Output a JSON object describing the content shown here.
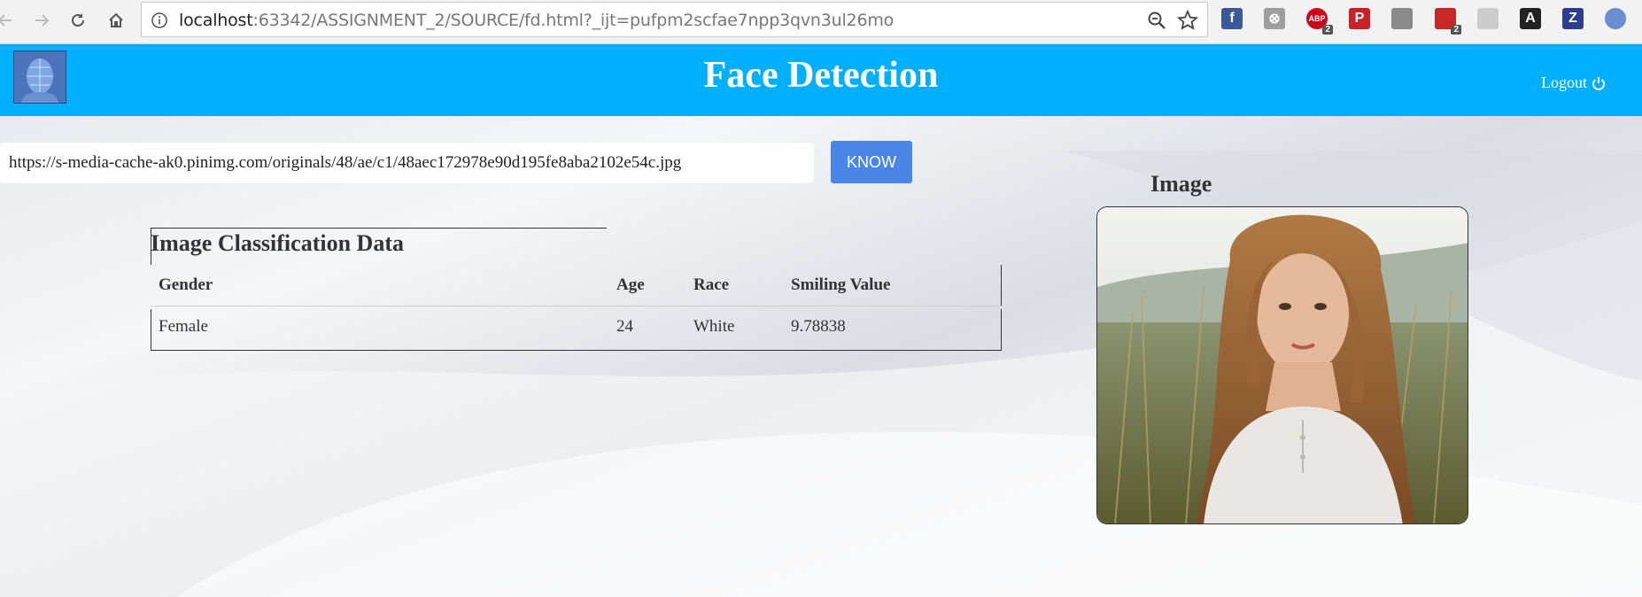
{
  "browser": {
    "url_host": "localhost",
    "url_rest": ":63342/ASSIGNMENT_2/SOURCE/fd.html?_ijt=pufpm2scfae7npp3qvn3ul26mo",
    "extensions": [
      {
        "name": "facebook-extension-icon",
        "glyph": "f",
        "color": "#3b5998"
      },
      {
        "name": "blocker-extension-icon",
        "glyph": "⊗",
        "color": "#9e9e9e"
      },
      {
        "name": "adblock-plus-extension-icon",
        "glyph": "ABP",
        "color": "#d0021b",
        "badge": "2"
      },
      {
        "name": "pinterest-extension-icon",
        "glyph": "P",
        "color": "#cb2027"
      },
      {
        "name": "grey-extension-icon",
        "glyph": "",
        "color": "#8a8a8a"
      },
      {
        "name": "ublock-extension-icon",
        "glyph": "",
        "color": "#c62828",
        "badge": "2"
      },
      {
        "name": "puzzle-extension-icon",
        "glyph": "",
        "color": "#cccccc"
      },
      {
        "name": "a-extension-icon",
        "glyph": "A",
        "color": "#222222"
      },
      {
        "name": "zotero-extension-icon",
        "glyph": "Z",
        "color": "#2c3e8c"
      },
      {
        "name": "globe-extension-icon",
        "glyph": "",
        "color": "#6a8fd0"
      }
    ]
  },
  "header": {
    "title": "Face Detection",
    "logout_label": "Logout"
  },
  "search": {
    "value": "https://s-media-cache-ak0.pinimg.com/originals/48/ae/c1/48aec172978e90d195fe8aba2102e54c.jpg",
    "button_label": "KNOW"
  },
  "image_panel": {
    "label": "Image"
  },
  "classification": {
    "caption": "Image Classification Data",
    "headers": [
      "Gender",
      "Age",
      "Race",
      "Smiling Value"
    ],
    "rows": [
      [
        "Female",
        "24",
        "White",
        "9.78838"
      ]
    ]
  },
  "colors": {
    "header_bg": "#00b0ff",
    "button_bg": "#4a86e8"
  }
}
